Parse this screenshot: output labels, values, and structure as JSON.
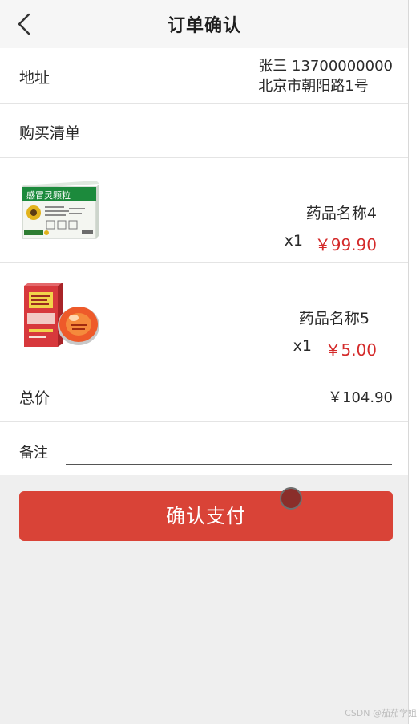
{
  "header": {
    "back_icon": "chevron-left-icon",
    "title": "订单确认"
  },
  "address": {
    "label": "地址",
    "recipient_line": "张三 13700000000",
    "street_line": "北京市朝阳路1号"
  },
  "purchase_list": {
    "label": "购买清单"
  },
  "items": [
    {
      "image": "cold-granules-medicine-box",
      "name": "药品名称4",
      "qty": "x1",
      "price": "￥99.90"
    },
    {
      "image": "red-medicine-box-with-tin",
      "name": "药品名称5",
      "qty": "x1",
      "price": "￥5.00"
    }
  ],
  "total": {
    "label": "总价",
    "value": "￥104.90"
  },
  "remark": {
    "label": "备注",
    "value": ""
  },
  "pay_button": {
    "label": "确认支付"
  },
  "colors": {
    "price": "#d42a2a",
    "pay_button": "#d94337",
    "header_bg": "#f6f6f6",
    "page_bg": "#efefef"
  },
  "watermark": "CSDN @茄茄学姐"
}
